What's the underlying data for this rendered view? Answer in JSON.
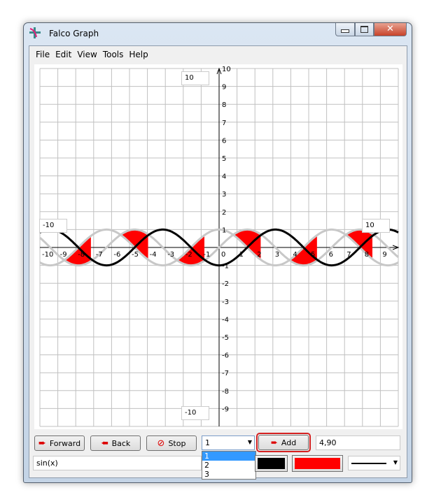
{
  "window": {
    "title": "Falco Graph",
    "minimize": "minimize",
    "maximize": "maximize",
    "close": "close"
  },
  "menu": [
    "File",
    "Edit",
    "View",
    "Tools",
    "Help"
  ],
  "graph_boxes": {
    "y_max": "10",
    "y_min": "-10",
    "x_min": "-10",
    "x_max": "10"
  },
  "toolbar": {
    "forward": "Forward",
    "back": "Back",
    "stop": "Stop",
    "add": "Add",
    "index_select": "1",
    "index_options": [
      "1",
      "2",
      "3"
    ],
    "coords": "4,90",
    "function_input": "sin(x)",
    "line_color": "#000000",
    "fill_color": "#ff0000"
  },
  "chart_data": {
    "type": "line",
    "xlim": [
      -10,
      10
    ],
    "ylim": [
      -10,
      10
    ],
    "grid": true,
    "x_ticks": [
      "-10",
      "-9",
      "-8",
      "-7",
      "-6",
      "-5",
      "-4",
      "-3",
      "-2",
      "-1",
      "0",
      "1",
      "2",
      "3",
      "4",
      "5",
      "6",
      "7",
      "8",
      "9"
    ],
    "y_ticks": [
      "10",
      "9",
      "8",
      "7",
      "6",
      "5",
      "4",
      "3",
      "2",
      "1",
      "-1",
      "-2",
      "-3",
      "-4",
      "-5",
      "-6",
      "-7",
      "-8",
      "-9"
    ],
    "series": [
      {
        "expr": "cos(x)",
        "color": "#c8c8c8"
      },
      {
        "expr": "sin(x)",
        "color": "#c8c8c8"
      },
      {
        "expr": "-cos(x)",
        "color": "#000000"
      }
    ],
    "fill": {
      "color": "#ff0000",
      "between": [
        "sin(x)",
        "cos(x)"
      ]
    }
  }
}
